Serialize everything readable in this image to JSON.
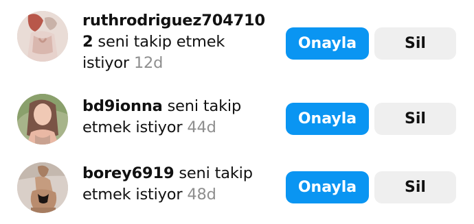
{
  "requests": [
    {
      "username_part1": "ruthrodriguez704710",
      "username_part2": "2",
      "action_text_line1": " seni takip etmek",
      "action_text_line2": "istiyor ",
      "time": "12d",
      "confirm_label": "Onayla",
      "delete_label": "Sil",
      "avatar_icon": "user-photo-1"
    },
    {
      "username": "bd9ionna",
      "action_text_line1": " seni takip",
      "action_text_line2": "etmek istiyor ",
      "time": "44d",
      "confirm_label": "Onayla",
      "delete_label": "Sil",
      "avatar_icon": "user-photo-2"
    },
    {
      "username": "borey6919",
      "action_text_line1": " seni takip",
      "action_text_line2": "etmek istiyor ",
      "time": "48d",
      "confirm_label": "Onayla",
      "delete_label": "Sil",
      "avatar_icon": "user-photo-3"
    }
  ],
  "colors": {
    "confirm_bg": "#0a95f2",
    "delete_bg": "#efefef",
    "time_text": "#8e8e8e"
  }
}
